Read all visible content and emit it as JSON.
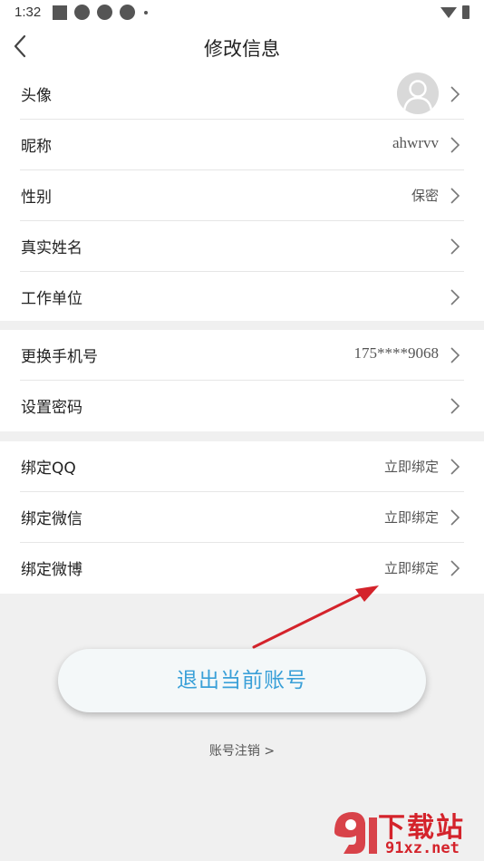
{
  "status_bar": {
    "time": "1:32"
  },
  "header": {
    "title": "修改信息"
  },
  "groups": [
    {
      "rows": [
        {
          "label": "头像",
          "value": ""
        },
        {
          "label": "昵称",
          "value": "ahwrvv"
        },
        {
          "label": "性别",
          "value": "保密"
        },
        {
          "label": "真实姓名",
          "value": ""
        },
        {
          "label": "工作单位",
          "value": ""
        }
      ]
    },
    {
      "rows": [
        {
          "label": "更换手机号",
          "value": "175****9068"
        },
        {
          "label": "设置密码",
          "value": ""
        }
      ]
    },
    {
      "rows": [
        {
          "label": "绑定QQ",
          "value": "立即绑定"
        },
        {
          "label": "绑定微信",
          "value": "立即绑定"
        },
        {
          "label": "绑定微博",
          "value": "立即绑定"
        }
      ]
    }
  ],
  "logout_button": {
    "label": "退出当前账号"
  },
  "cancel_account": {
    "label": "账号注销  >"
  },
  "watermark": {
    "cn": "下载站",
    "en": "91xz.net"
  },
  "colors": {
    "accent": "#3aa0d8",
    "annotation_arrow": "#d4232b"
  }
}
